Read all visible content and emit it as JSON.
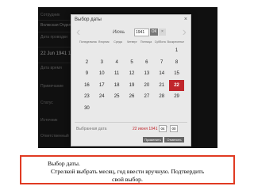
{
  "background": {
    "lines": [
      "Сотрудник",
      "Волжская Отделение",
      "Дата проводки",
      "22 Jun 1941 16:00",
      "Дата время",
      "Примечание",
      "Статус",
      "Источник",
      "Ответственный"
    ]
  },
  "dialog": {
    "title": "Выбор даты",
    "close_icon": "×",
    "prev_icon": "‹",
    "next_icon": "›",
    "month": "Июнь",
    "year": "1941",
    "ok_label": "ОК",
    "x_label": "×",
    "weekdays": [
      "Понедельник",
      "Вторник",
      "Среда",
      "Четверг",
      "Пятница",
      "Суббота",
      "Воскресенье"
    ],
    "days": [
      "",
      "",
      "",
      "",
      "",
      "",
      "1",
      "2",
      "3",
      "4",
      "5",
      "6",
      "7",
      "8",
      "9",
      "10",
      "11",
      "12",
      "13",
      "14",
      "15",
      "16",
      "17",
      "18",
      "19",
      "20",
      "21",
      "22",
      "23",
      "24",
      "25",
      "26",
      "27",
      "28",
      "29",
      "30",
      "",
      "",
      "",
      "",
      "",
      ""
    ],
    "selected_day": "22",
    "selected_label": "Выбранная дата",
    "selected_value": "22 июня 1941",
    "hour": "04",
    "minutes": "00",
    "confirm_label": "Применить",
    "cancel_label": "Отменить"
  },
  "colors": {
    "accent": "#c0262c",
    "caption_border": "#e03a22"
  },
  "caption": {
    "line1": "Выбор даты.",
    "line2": "Стрелкой выбрать месяц, год ввести вручную. Подтвердить",
    "line3": "свой выбор."
  }
}
